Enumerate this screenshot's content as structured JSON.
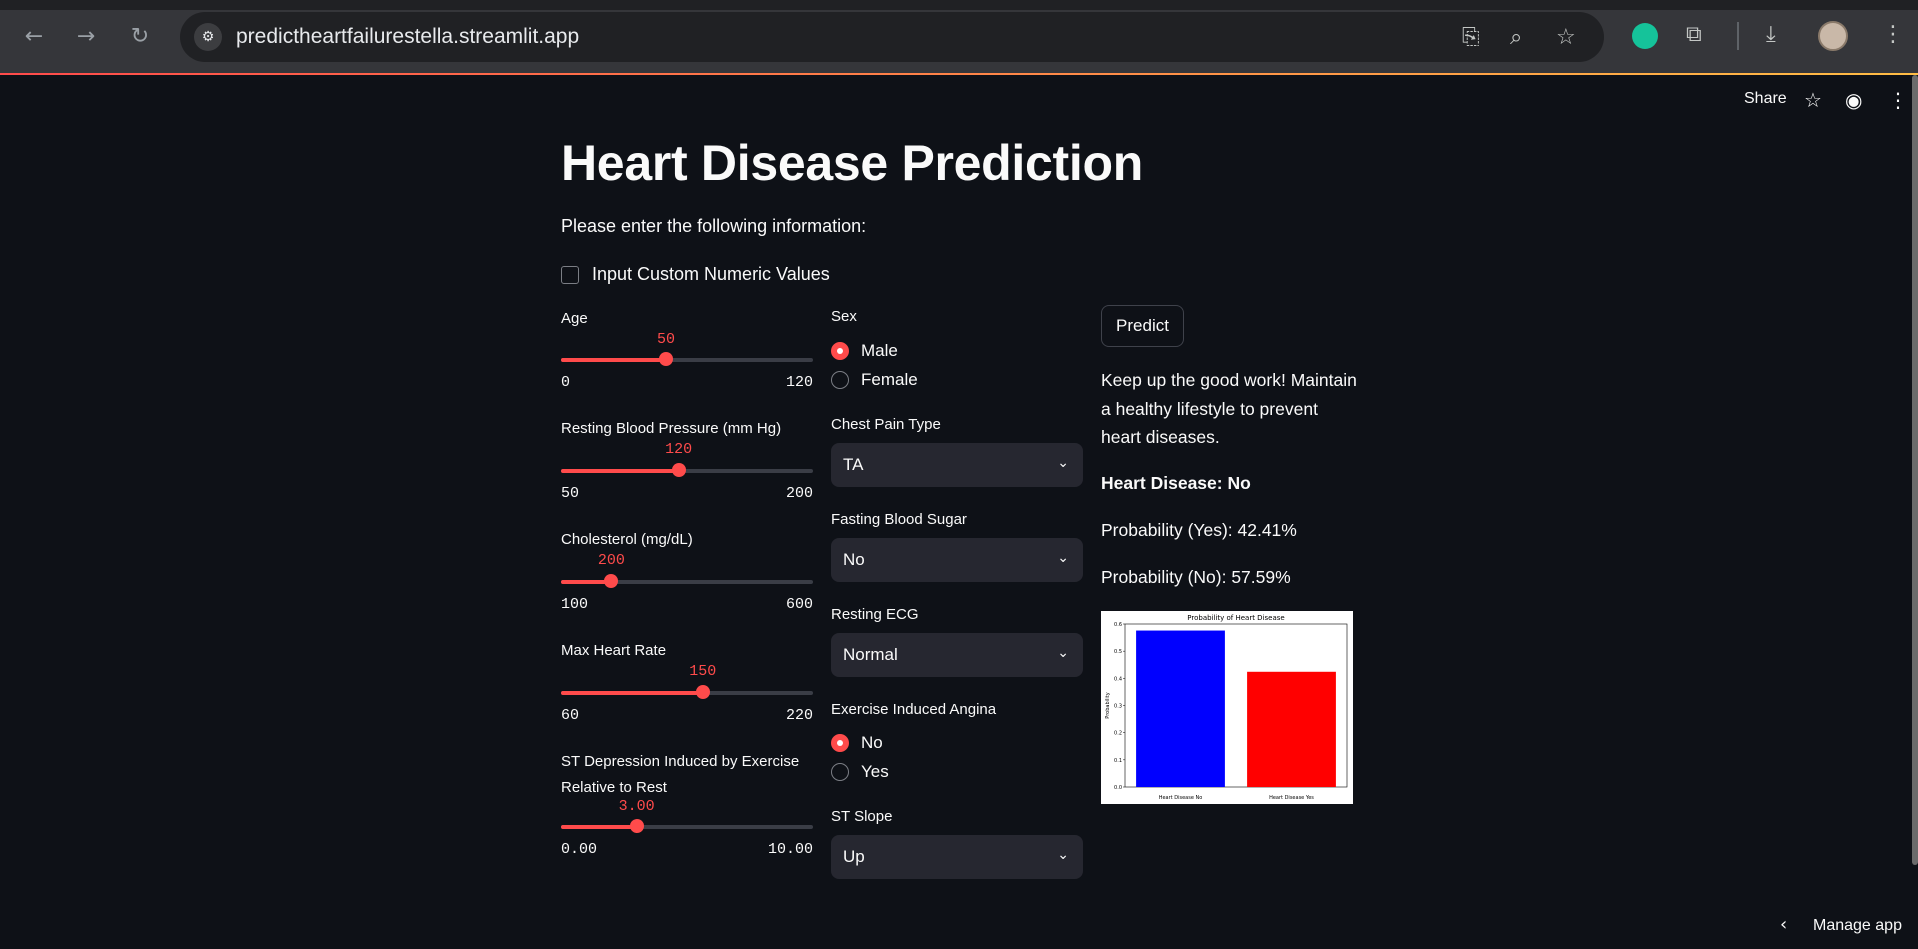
{
  "browser": {
    "url": "predictheartfailurestella.streamlit.app"
  },
  "streamlit_header": {
    "share_label": "Share"
  },
  "main": {
    "title": "Heart Disease Prediction",
    "subtitle": "Please enter the following information:",
    "custom_values_checkbox": {
      "label": "Input Custom Numeric Values",
      "checked": false
    }
  },
  "sliders": [
    {
      "label": "Age",
      "value": "50",
      "min": "0",
      "max": "120",
      "fraction": 0.4167
    },
    {
      "label": "Resting Blood Pressure (mm Hg)",
      "value": "120",
      "min": "50",
      "max": "200",
      "fraction": 0.4667
    },
    {
      "label": "Cholesterol (mg/dL)",
      "value": "200",
      "min": "100",
      "max": "600",
      "fraction": 0.2
    },
    {
      "label": "Max Heart Rate",
      "value": "150",
      "min": "60",
      "max": "220",
      "fraction": 0.5625
    },
    {
      "label": "ST Depression Induced by Exercise Relative to Rest",
      "label_line1": "ST Depression Induced by Exercise",
      "label_line2": "Relative to Rest",
      "value": "3.00",
      "min": "0.00",
      "max": "10.00",
      "fraction": 0.3
    }
  ],
  "sex": {
    "label": "Sex",
    "options": [
      "Male",
      "Female"
    ],
    "selected": "Male"
  },
  "chest_pain": {
    "label": "Chest Pain Type",
    "value": "TA"
  },
  "fasting_bs": {
    "label": "Fasting Blood Sugar",
    "value": "No"
  },
  "resting_ecg": {
    "label": "Resting ECG",
    "value": "Normal"
  },
  "angina": {
    "label": "Exercise Induced Angina",
    "options": [
      "No",
      "Yes"
    ],
    "selected": "No"
  },
  "st_slope": {
    "label": "ST Slope",
    "value": "Up"
  },
  "predict_button": "Predict",
  "result": {
    "message": "Keep up the good work! Maintain a healthy lifestyle to prevent heart diseases.",
    "heart_disease": "Heart Disease: No",
    "prob_yes": "Probability (Yes): 42.41%",
    "prob_no": "Probability (No): 57.59%"
  },
  "manage_app": "Manage app",
  "colors": {
    "accent": "#ff4b4b",
    "background": "#0e1117",
    "widget_bg": "#262730"
  },
  "chart_data": {
    "type": "bar",
    "title": "Probability of Heart Disease",
    "categories": [
      "Heart Disease No",
      "Heart Disease Yes"
    ],
    "values": [
      0.5759,
      0.4241
    ],
    "colors": [
      "#0000ff",
      "#ff0000"
    ],
    "xlabel": "",
    "ylabel": "Probability",
    "ylim": [
      0,
      0.6
    ],
    "yticks": [
      "0.0",
      "0.1",
      "0.2",
      "0.3",
      "0.4",
      "0.5",
      "0.6"
    ]
  }
}
